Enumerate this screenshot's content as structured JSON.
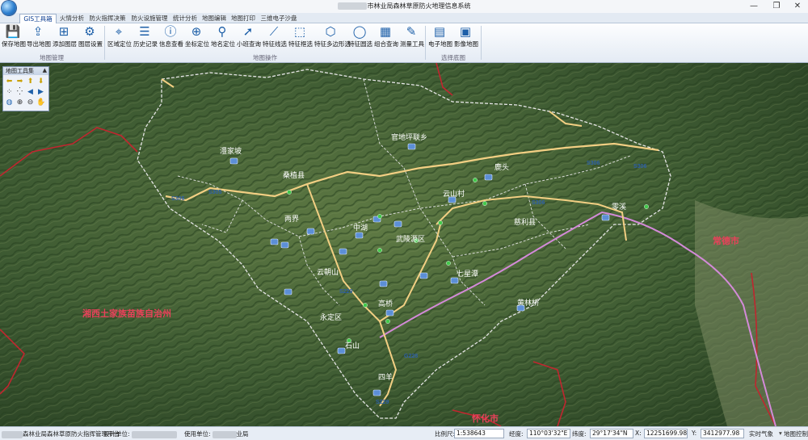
{
  "window": {
    "title": "市林业局森林草原防火地理信息系统",
    "minimize": "—",
    "maximize": "❐",
    "close": "✕"
  },
  "tabs": [
    "GIS工具箱",
    "火情分析",
    "防火指挥决策",
    "防火设施管理",
    "统计分析",
    "地图编辑",
    "地图打印",
    "三维电子沙盘"
  ],
  "ribbon": {
    "groups": [
      {
        "label": "地图管理",
        "buttons": [
          {
            "label": "保存地图",
            "icon": "save-icon",
            "glyph": "💾"
          },
          {
            "label": "导出地图",
            "icon": "export-icon",
            "glyph": "⇪"
          },
          {
            "label": "添加图层",
            "icon": "add-layer-icon",
            "glyph": "⊞"
          },
          {
            "label": "图层设置",
            "icon": "layer-settings-icon",
            "glyph": "⚙"
          }
        ]
      },
      {
        "label": "地图操作",
        "buttons": [
          {
            "label": "区域定位",
            "icon": "location-pin-icon",
            "glyph": "⌖"
          },
          {
            "label": "历史记录",
            "icon": "history-icon",
            "glyph": "☰"
          },
          {
            "label": "信息查看",
            "icon": "info-icon",
            "glyph": "ⓘ"
          },
          {
            "label": "坐标定位",
            "icon": "crosshair-icon",
            "glyph": "⊕"
          },
          {
            "label": "地名定位",
            "icon": "place-pin-icon",
            "glyph": "⚲"
          },
          {
            "label": "小班查询",
            "icon": "pointer-icon",
            "glyph": "➚"
          },
          {
            "label": "特征线选",
            "icon": "line-select-icon",
            "glyph": "⟋"
          },
          {
            "label": "特征框选",
            "icon": "box-select-icon",
            "glyph": "⬚"
          },
          {
            "label": "特征多边形选",
            "icon": "polygon-select-icon",
            "glyph": "⬡"
          },
          {
            "label": "特征圆选",
            "icon": "circle-select-icon",
            "glyph": "◯"
          },
          {
            "label": "组合查询",
            "icon": "query-icon",
            "glyph": "▦"
          },
          {
            "label": "测量工具",
            "icon": "ruler-icon",
            "glyph": "✎"
          }
        ]
      },
      {
        "label": "选择底图",
        "buttons": [
          {
            "label": "电子地图",
            "icon": "vector-map-icon",
            "glyph": "▤"
          },
          {
            "label": "影像地图",
            "icon": "imagery-map-icon",
            "glyph": "▣"
          }
        ]
      }
    ]
  },
  "toolbox": {
    "title": "地图工具集",
    "close": "▲"
  },
  "map": {
    "places": [
      {
        "name": "官地坪联乡"
      },
      {
        "name": "桑植县"
      },
      {
        "name": "慈利县"
      },
      {
        "name": "武陵源区"
      },
      {
        "name": "永定区"
      },
      {
        "name": "澧家坡"
      },
      {
        "name": "鹿头"
      },
      {
        "name": "云山村"
      },
      {
        "name": "中湖"
      },
      {
        "name": "两界"
      },
      {
        "name": "云朝山"
      },
      {
        "name": "七星潭"
      },
      {
        "name": "黄林桥"
      },
      {
        "name": "高桥"
      },
      {
        "name": "石山"
      },
      {
        "name": "四羊"
      },
      {
        "name": "零溪"
      }
    ],
    "regions": [
      {
        "name": "湘西土家族苗族自治州"
      },
      {
        "name": "常德市"
      },
      {
        "name": "怀化市"
      }
    ],
    "roads": [
      "S306",
      "S305",
      "S229",
      "S306",
      "S306",
      "S306",
      "G228",
      "S229"
    ]
  },
  "statusbar": {
    "org_label": "森林业局森林草原防火指挥管理平台",
    "designer_label": "设计单位:",
    "user_label": "使用单位:",
    "user_value": "业局",
    "scale_label": "比例尺:",
    "scale_value": "1:538643",
    "lon_label": "经度:",
    "lon_value": "110°03'32\"E",
    "lat_label": "纬度:",
    "lat_value": "29°17'34\"N",
    "x_label": "X:",
    "x_value": "12251699.98",
    "y_label": "Y:",
    "y_value": "3412977.98",
    "weather": "实时气象",
    "map_tool": "地图控制"
  },
  "colors": {
    "ribbon_icon": "#1d5fa8",
    "boundary": "#e5e5e5",
    "road": "#f2cf83",
    "rail": "#d38ad8",
    "province_line": "#c0262f",
    "region_label": "#e9415a"
  }
}
